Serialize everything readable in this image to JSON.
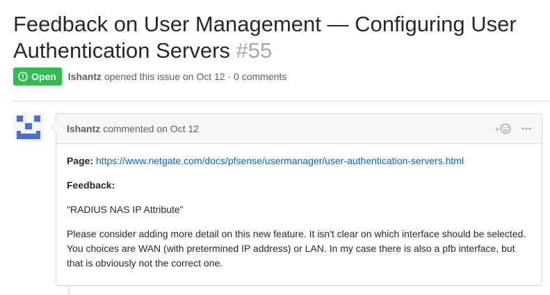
{
  "issue": {
    "title": "Feedback on User Management — Configuring User Authentication Servers",
    "number": "#55",
    "state": "Open",
    "author": "lshantz",
    "opened_text": "opened this issue on Oct 12 · 0 comments"
  },
  "comment": {
    "author": "lshantz",
    "verb": "commented",
    "date_text": "on Oct 12",
    "reaction_label": "+",
    "page_label": "Page:",
    "page_url": "https://www.netgate.com/docs/pfsense/usermanager/user-authentication-servers.html",
    "feedback_label": "Feedback:",
    "quote": "\"RADIUS NAS IP Attribute\"",
    "body": "Please consider adding more detail on this new feature. It isn't clear on which interface should be selected. You choices are WAN (with pretermined IP address) or LAN. In my case there is also a pfb interface, but that is obviously not the correct one."
  },
  "icons": {
    "state": "issue-opened-icon",
    "reaction": "smiley-icon",
    "more": "kebab-horizontal-icon"
  },
  "colors": {
    "open_green": "#2cbe4e",
    "link_blue": "#0366d6",
    "avatar_blue": "#4c6ed8"
  }
}
